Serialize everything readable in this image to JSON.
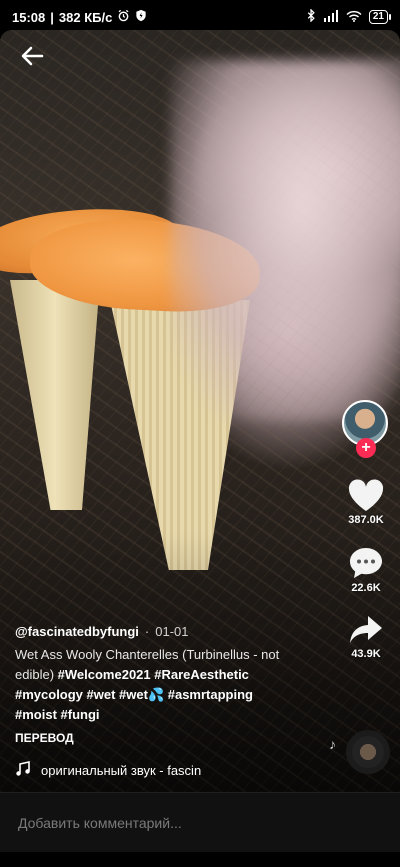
{
  "status_bar": {
    "time": "15:08",
    "speed": "382 КБ/с",
    "battery": "21"
  },
  "video": {
    "author": "@fascinatedbyfungi",
    "date": "01-01",
    "description_text": "Wet Ass Wooly Chanterelles (Turbinellus - not edible)",
    "hashtags_line1": "#Welcome2021 #RareAesthetic",
    "hashtags_line2": "#mycology #wet #wet💦 #asmrtapping",
    "hashtags_line3": "#moist #fungi",
    "translate_label": "ПЕРЕВОД",
    "sound": "оригинальный звук - fascinatedbyfungi"
  },
  "actions": {
    "likes": "387.0K",
    "comments": "22.6K",
    "shares": "43.9K"
  },
  "comment_bar": {
    "placeholder": "Добавить комментарий..."
  },
  "colors": {
    "follow_badge": "#fe2c55",
    "background": "#000000"
  },
  "icons": [
    "back-arrow-icon",
    "heart-icon",
    "comment-icon",
    "share-icon",
    "music-note-icon",
    "plus-icon"
  ]
}
